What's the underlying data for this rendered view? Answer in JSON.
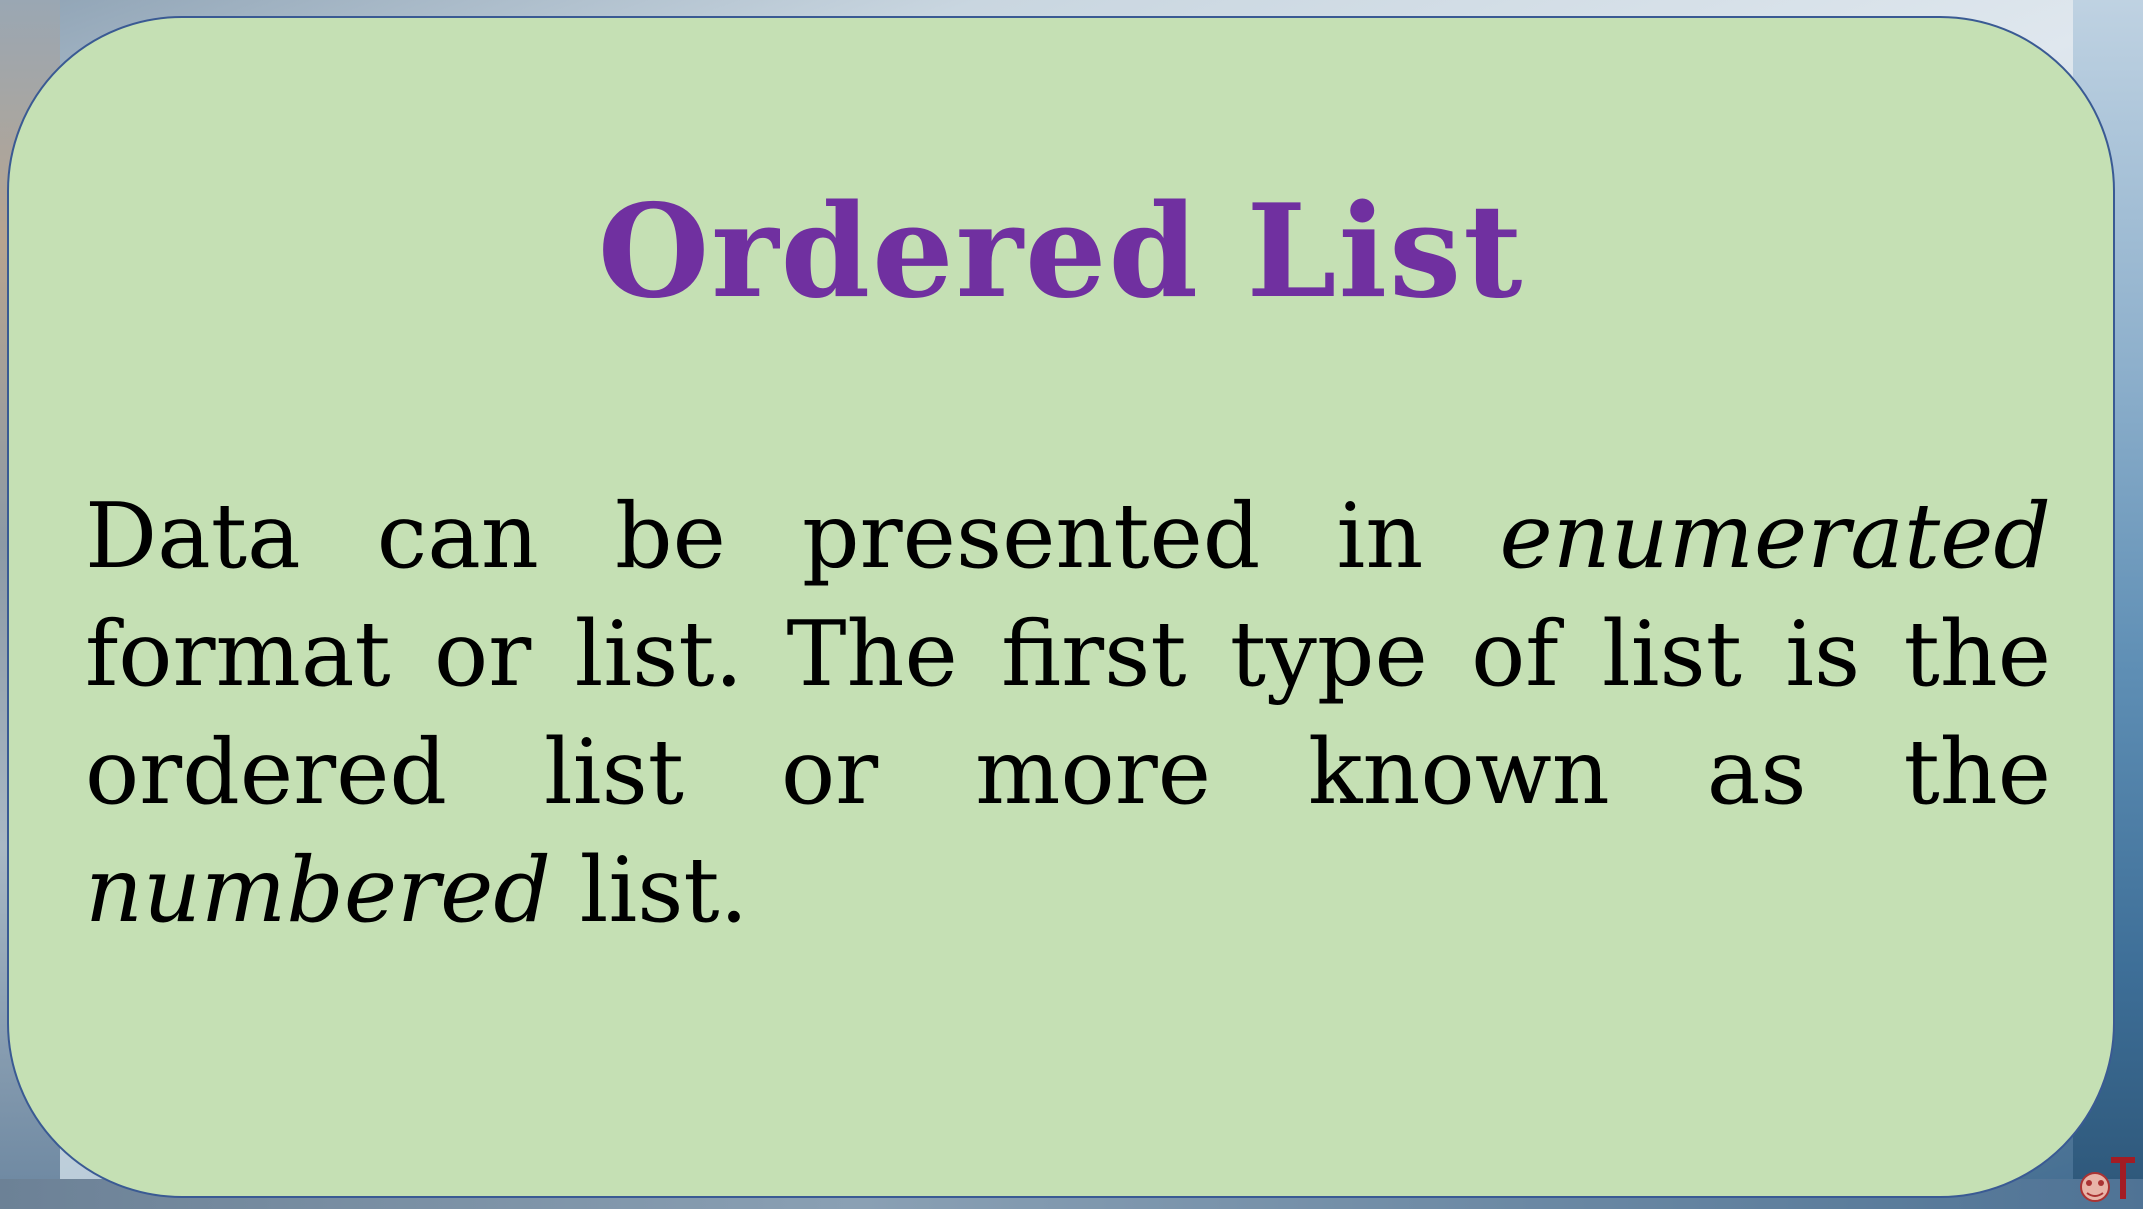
{
  "slide": {
    "title": "Ordered List",
    "paragraph": {
      "part1": "Data can be presented in ",
      "emphasis1": "enumerated",
      "part2": " format or list.  The first type of list is the ordered list or more known as the ",
      "emphasis2": "numbered",
      "part3": " list."
    }
  },
  "colors": {
    "card_background": "#c5e0b4",
    "card_border": "#3a5a93",
    "title": "#7030a0",
    "body_text": "#000000"
  },
  "icons": {
    "corner_logo": "logo-icon"
  }
}
